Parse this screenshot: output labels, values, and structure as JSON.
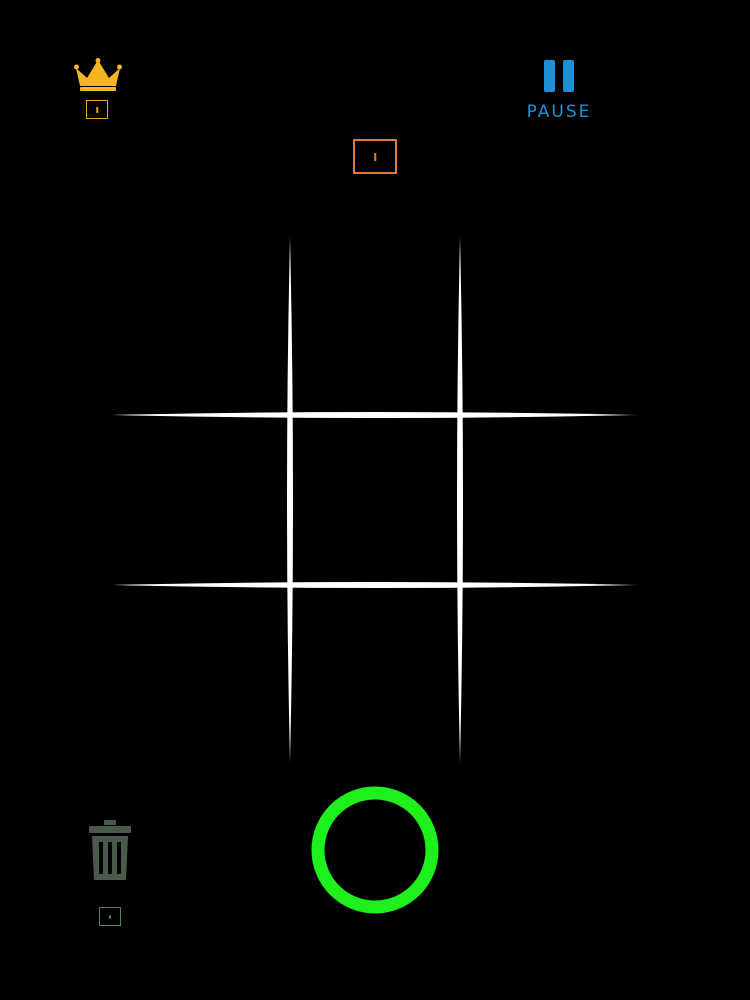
{
  "topbar": {
    "crown_icon": "crown-icon",
    "best_score_value": "",
    "pause_icon": "pause-icon",
    "pause_label": "PAUSE",
    "current_score_value": ""
  },
  "board": {
    "rows": 3,
    "cols": 3,
    "cells": [
      "",
      "",
      "",
      "",
      "",
      "",
      "",
      "",
      ""
    ]
  },
  "bottom": {
    "trash_icon": "trash-icon",
    "trash_count_value": "",
    "turn_piece": "O"
  },
  "colors": {
    "background": "#000000",
    "grid": "#ffffff",
    "crown": "#f5b622",
    "best_box": "#e8a419",
    "pause": "#1e90d6",
    "score_box": "#e07a3a",
    "trash": "#4a5a4a",
    "trash_box": "#4f8a52",
    "turn_piece": "#1ef01e"
  }
}
